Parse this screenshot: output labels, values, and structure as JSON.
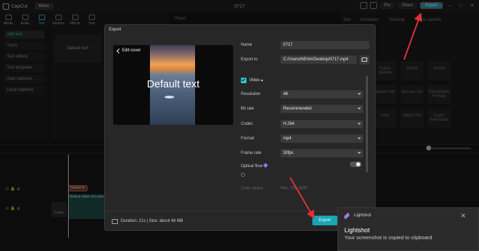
{
  "app": {
    "name": "CapCut",
    "menu_label": "Menu",
    "window_title": "0717",
    "pro_label": "Pro",
    "share_label": "Share",
    "export_label": "Export",
    "accent_color": "#1aa5b3"
  },
  "toolbar": {
    "tools": [
      {
        "label": "Media",
        "icon": "media-icon"
      },
      {
        "label": "Audio",
        "icon": "audio-icon"
      },
      {
        "label": "Text",
        "icon": "text-icon"
      },
      {
        "label": "Stickers",
        "icon": "stickers-icon"
      },
      {
        "label": "Effects",
        "icon": "effects-icon"
      },
      {
        "label": "Tran",
        "icon": "transitions-icon"
      }
    ],
    "active_tool": "Text"
  },
  "left_panel": {
    "items": [
      "Add text",
      "Yours",
      "Text effects",
      "Text template",
      "Auto captions",
      "Local captions"
    ]
  },
  "text_panel": {
    "default_card": "Default text"
  },
  "player": {
    "label": "Player"
  },
  "right_panel": {
    "tabs": [
      "Text",
      "Animation",
      "Tracking",
      "Text to speech"
    ],
    "voices": [
      "Suara Wanita",
      "Shinta",
      "Jessie",
      "Heilam Min",
      "Serious Girl",
      "Empathetic Female",
      "Icha",
      "Valley Girl",
      "Gadis Berbicara"
    ]
  },
  "timeline": {
    "text_clip": "Default te",
    "video_clip": "Vertical video of a sea",
    "cover_label": "Cover"
  },
  "export_dialog": {
    "title": "Export",
    "edit_cover": "Edit cover",
    "preview_caption": "Default text",
    "name_label": "Name",
    "name_value": "0717",
    "export_to_label": "Export to",
    "export_to_value": "C:/Users/NEHA/Desktop/0717.mp4",
    "video_section": "Video",
    "video_checked": true,
    "resolution_label": "Resolution",
    "resolution_value": "4K",
    "bitrate_label": "Bit rate",
    "bitrate_value": "Recommended",
    "codec_label": "Codec",
    "codec_value": "H.264",
    "format_label": "Format",
    "format_value": "mp4",
    "framerate_label": "Frame rate",
    "framerate_value": "30fps",
    "optical_flow_label": "Optical flow",
    "optical_flow_on": false,
    "color_space_label": "Color space",
    "color_space_value": "Rec. 709 SDR",
    "footer_info": "Duration: 21s | Size: about 48 MB",
    "export_button": "Export"
  },
  "notification": {
    "app_name": "Lightshot",
    "title": "Lightshot",
    "message": "Your screenshot is copied to clipboard"
  }
}
